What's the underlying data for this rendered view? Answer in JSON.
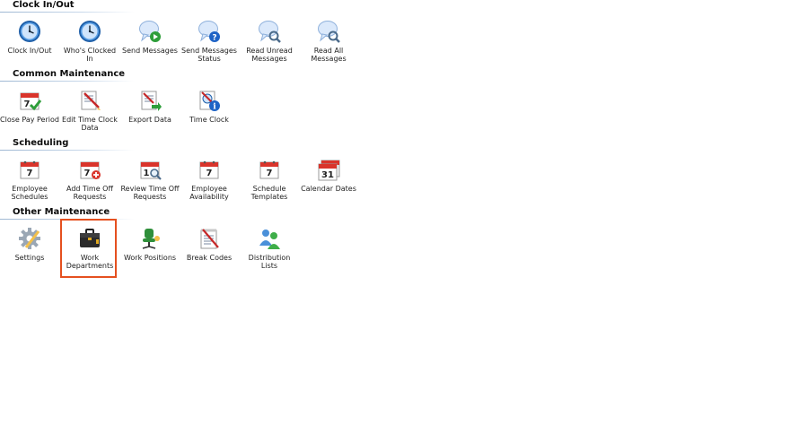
{
  "sections": [
    {
      "title": "Clock In/Out",
      "items": [
        {
          "label": "Clock In/Out",
          "icon": "clock-icon"
        },
        {
          "label": "Who's Clocked In",
          "icon": "clock-icon"
        },
        {
          "label": "Send Messages",
          "icon": "send-message-icon"
        },
        {
          "label": "Send Messages Status",
          "icon": "message-status-icon"
        },
        {
          "label": "Read Unread Messages",
          "icon": "read-message-icon"
        },
        {
          "label": "Read All Messages",
          "icon": "read-message-icon"
        }
      ]
    },
    {
      "title": "Common Maintenance",
      "items": [
        {
          "label": "Close Pay Period",
          "icon": "calendar-check-icon"
        },
        {
          "label": "Edit Time Clock Data",
          "icon": "edit-document-icon"
        },
        {
          "label": "Export Data",
          "icon": "export-document-icon"
        },
        {
          "label": "Time Clock",
          "icon": "time-clock-info-icon"
        }
      ]
    },
    {
      "title": "Scheduling",
      "items": [
        {
          "label": "Employee Schedules",
          "icon": "calendar-icon"
        },
        {
          "label": "Add Time Off Requests",
          "icon": "calendar-add-icon"
        },
        {
          "label": "Review Time Off Requests",
          "icon": "calendar-search-icon"
        },
        {
          "label": "Employee Availability",
          "icon": "calendar-icon"
        },
        {
          "label": "Schedule Templates",
          "icon": "calendar-icon"
        },
        {
          "label": "Calendar Dates",
          "icon": "calendar-dates-icon"
        }
      ]
    },
    {
      "title": "Other Maintenance",
      "items": [
        {
          "label": "Settings",
          "icon": "gear-icon"
        },
        {
          "label": "Work Departments",
          "icon": "briefcase-icon"
        },
        {
          "label": "Work Positions",
          "icon": "office-chair-icon"
        },
        {
          "label": "Break Codes",
          "icon": "notepad-pencil-icon"
        },
        {
          "label": "Distribution Lists",
          "icon": "users-group-icon"
        }
      ]
    }
  ],
  "selected_item": "Work Departments",
  "colors": {
    "highlight": "#e5501f",
    "section_rule": "#9fb8d3",
    "clock_face": "#2f7fd0",
    "bubble": "#dbe9fb",
    "calendar_red": "#d9342b"
  }
}
